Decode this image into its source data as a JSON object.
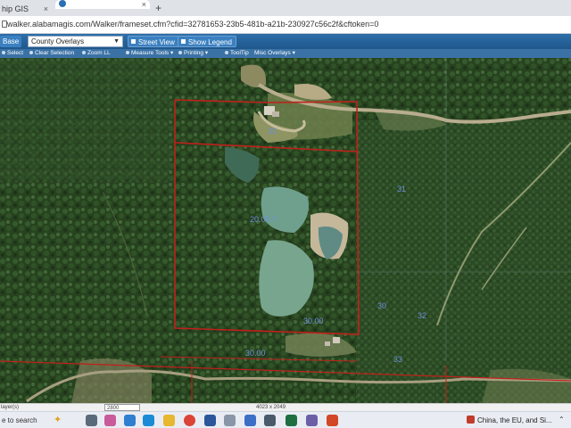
{
  "browser": {
    "tabs": [
      {
        "label": "hip GIS",
        "active": false
      },
      {
        "label": "Walker Public GIS",
        "active": true
      }
    ],
    "new_tab": "+",
    "close_glyph": "×",
    "url": "walker.alabamagis.com/Walker/frameset.cfm?cfid=32781653-23b5-481b-a21b-230927c56c2f&cftoken=0"
  },
  "app_toolbar": {
    "basemap_label": "Base",
    "overlay_select": "County Overlays",
    "street_view": "Street View",
    "show_legend": "Show Legend"
  },
  "tools": [
    "Select",
    "Clear Selection",
    "Zoom LL",
    "Measure Tools",
    "Printing",
    "ToolTip",
    "Misc Overlays"
  ],
  "map": {
    "labels": [
      "20.00 ?",
      "30.00",
      "30.00",
      "31",
      "30",
      "33",
      "32",
      "33"
    ],
    "parcel_line_color": "#c0211b",
    "label_color": "#6f8fd6"
  },
  "status_bar": {
    "layers": "layer(s)",
    "scale": "2800",
    "coords": "4023 x 2049"
  },
  "taskbar": {
    "search": "e to search",
    "news": "China, the EU, and Si..."
  }
}
